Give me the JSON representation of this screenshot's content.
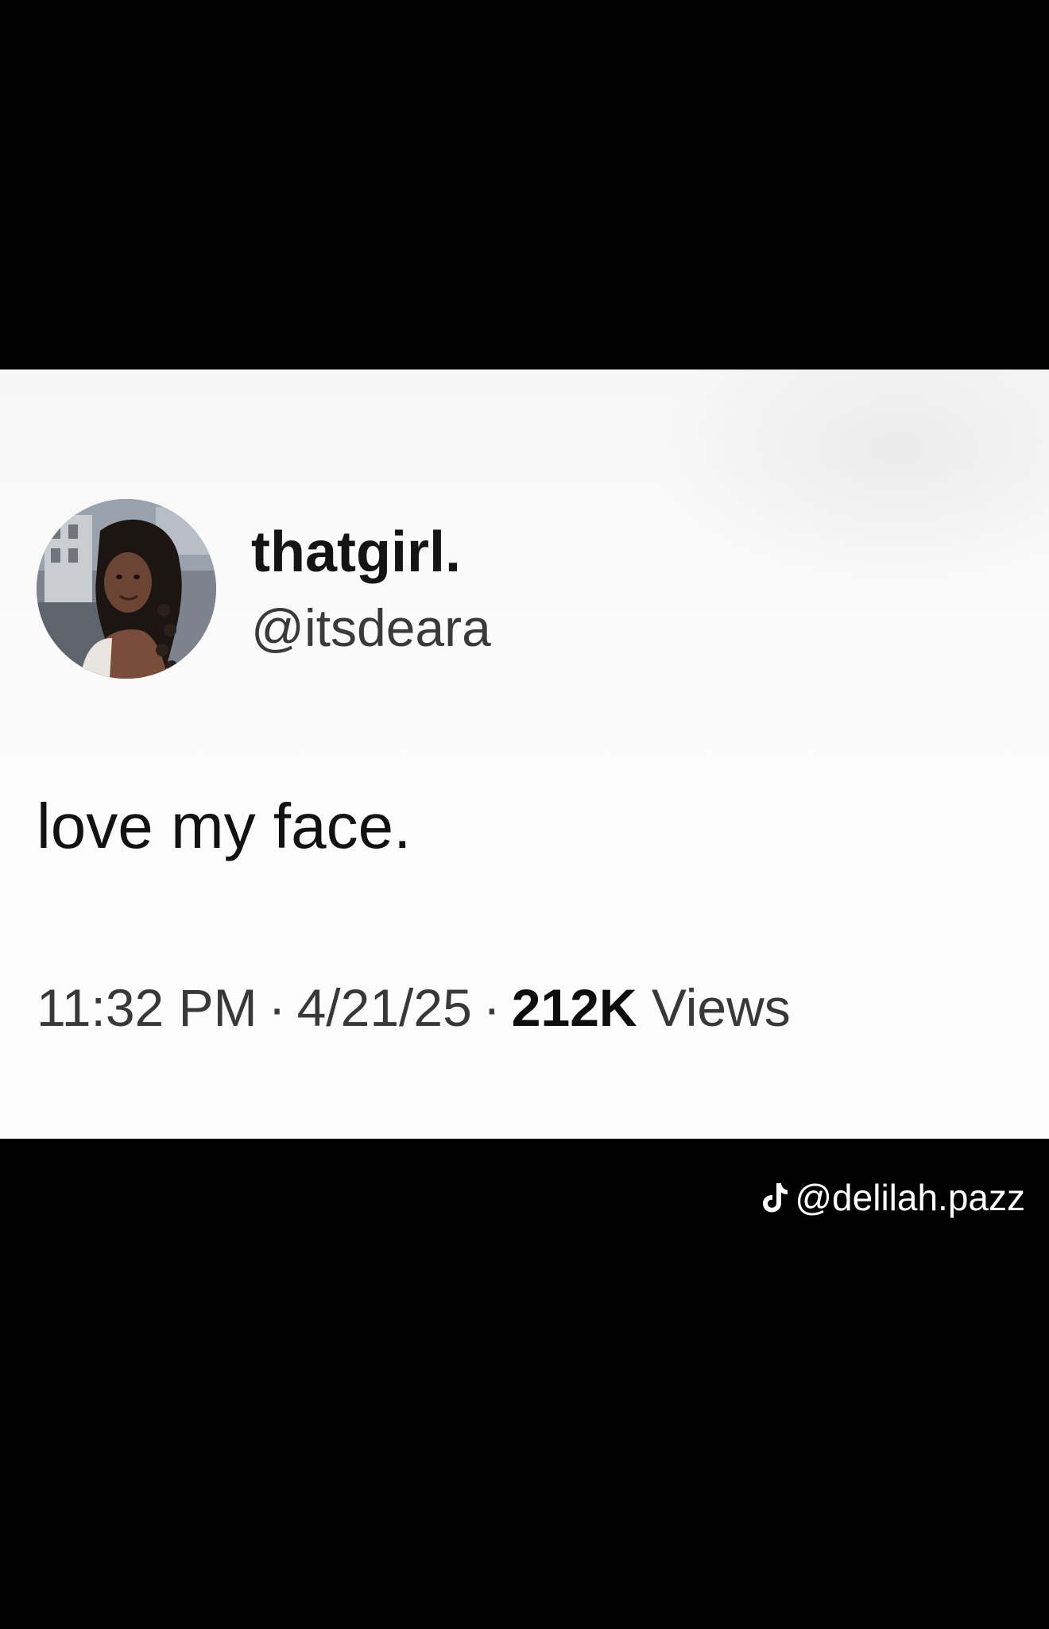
{
  "tweet": {
    "display_name": "thatgirl.",
    "handle": "@itsdeara",
    "text": "love my face.",
    "time": "11:32 PM",
    "date": "4/21/25",
    "separator": "·",
    "views_count": "212K",
    "views_label": "Views"
  },
  "watermark": {
    "icon": "tiktok-logo-icon",
    "username": "@delilah.pazz"
  }
}
